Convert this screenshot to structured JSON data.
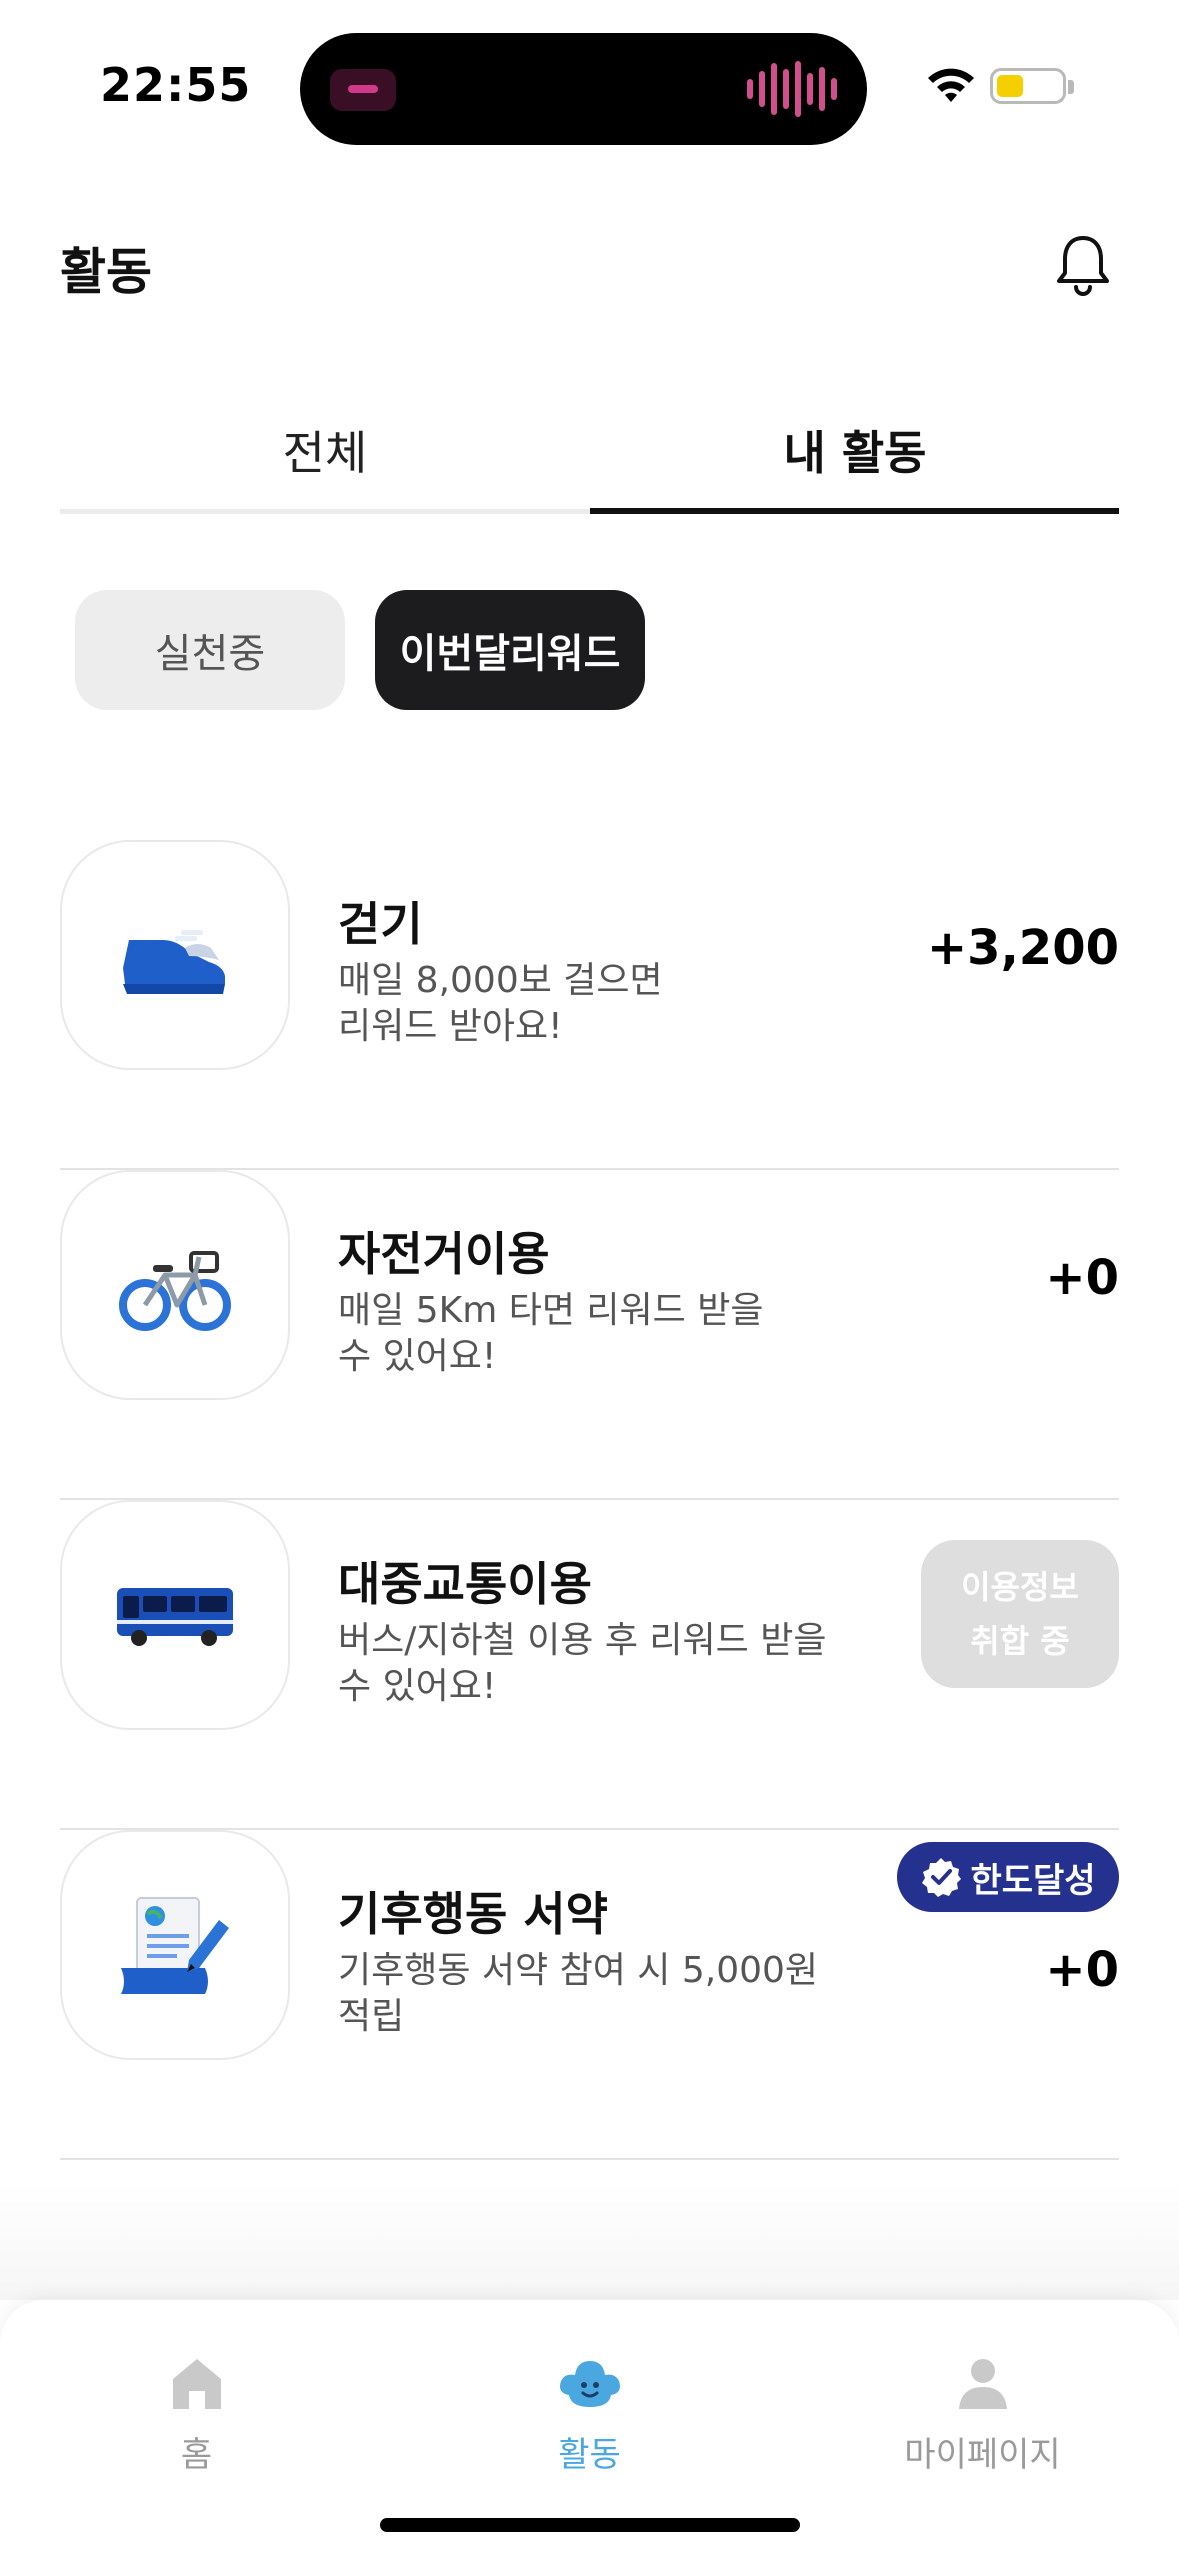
{
  "status_bar": {
    "time": "22:55"
  },
  "header": {
    "title": "활동"
  },
  "tabs": [
    {
      "label": "전체",
      "selected": false
    },
    {
      "label": "내 활동",
      "selected": true
    }
  ],
  "chips": [
    {
      "label": "실천중",
      "selected": false
    },
    {
      "label": "이번달리워드",
      "selected": true
    }
  ],
  "activities": [
    {
      "title": "걷기",
      "desc_line1": "매일 8,000보 걸으면",
      "desc_line2": "리워드 받아요!",
      "points": "+3,200",
      "icon": "sneaker-icon"
    },
    {
      "title": "자전거이용",
      "desc_line1": "매일 5Km 타면 리워드 받을",
      "desc_line2": "수 있어요!",
      "points": "+0",
      "icon": "bicycle-icon"
    },
    {
      "title": "대중교통이용",
      "desc_line1": "버스/지하철 이용 후 리워드 받을",
      "desc_line2": "수 있어요!",
      "status_line1": "이용정보",
      "status_line2": "취합 중",
      "icon": "bus-icon"
    },
    {
      "title": "기후행동 서약",
      "desc_line1": "기후행동 서약 참여 시 5,000원",
      "desc_line2": "적립",
      "badge": "한도달성",
      "points": "+0",
      "icon": "pledge-document-icon"
    }
  ],
  "bottom_nav": [
    {
      "label": "홈",
      "icon": "home-icon",
      "active": false
    },
    {
      "label": "활동",
      "icon": "cloud-mascot-icon",
      "active": true
    },
    {
      "label": "마이페이지",
      "icon": "person-icon",
      "active": false
    }
  ],
  "colors": {
    "accent_active_nav": "#4aa7e0",
    "badge_navy": "#24318f",
    "chip_dark": "#1c1c1e",
    "icon_blue": "#1f5fc9"
  }
}
